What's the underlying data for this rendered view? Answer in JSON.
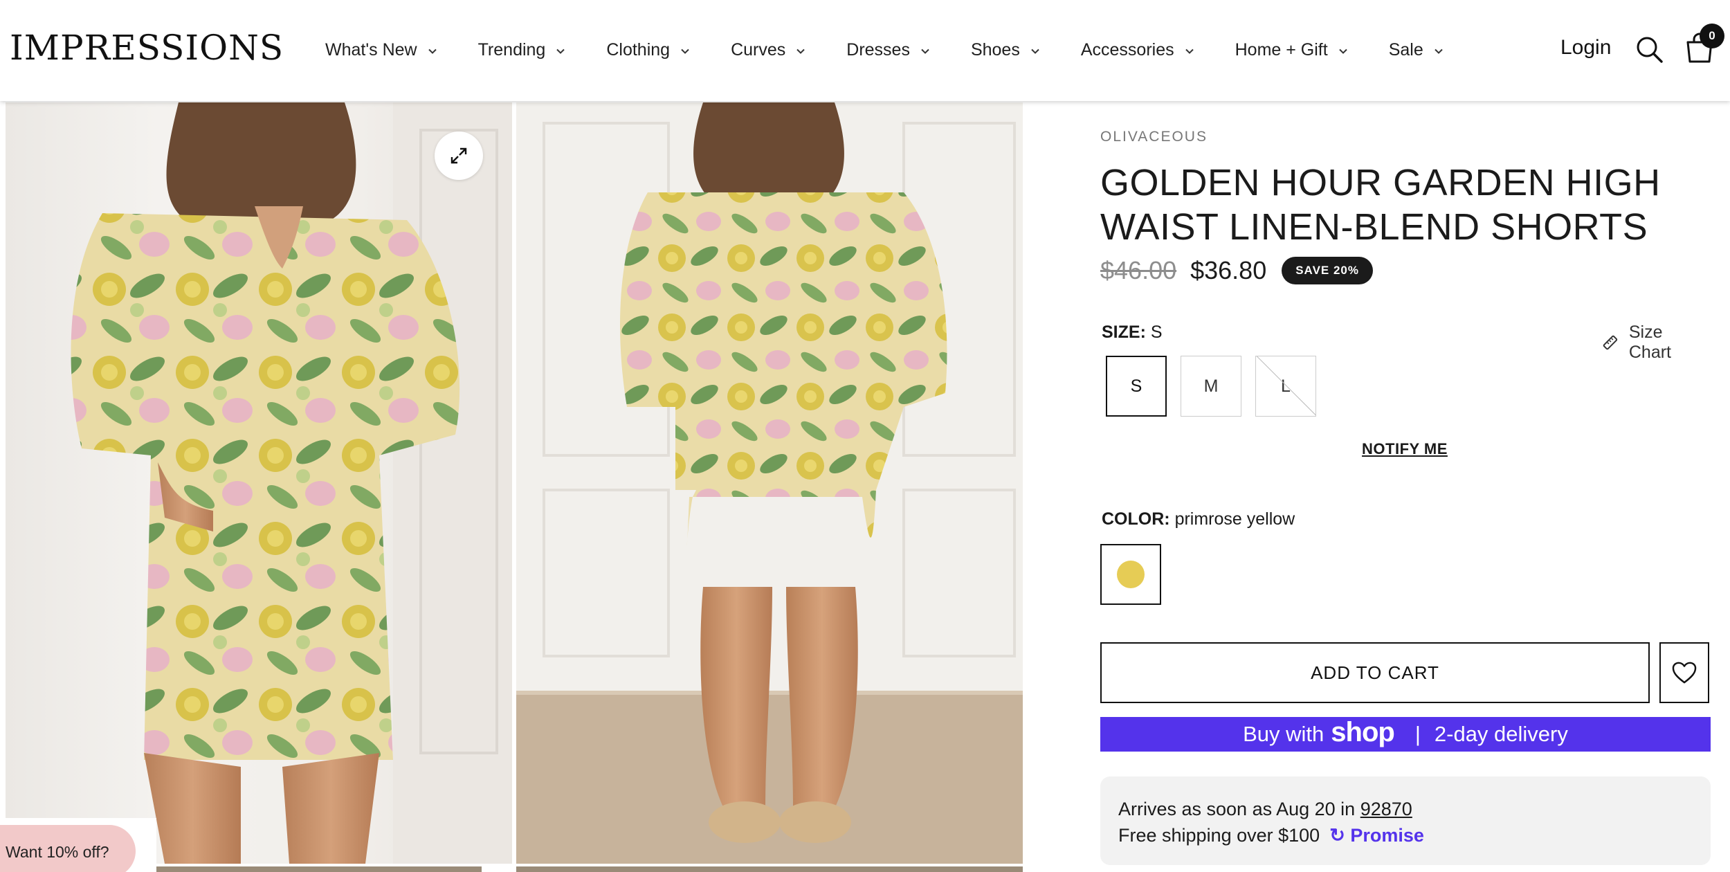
{
  "header": {
    "logo": "IMPRESSIONS",
    "nav": [
      "What's New",
      "Trending",
      "Clothing",
      "Curves",
      "Dresses",
      "Shoes",
      "Accessories",
      "Home + Gift",
      "Sale"
    ],
    "login": "Login",
    "cart_count": "0"
  },
  "gallery": {
    "promo": "Want 10% off?"
  },
  "product": {
    "brand": "OLIVACEOUS",
    "title": "GOLDEN HOUR GARDEN HIGH WAIST LINEN-BLEND SHORTS",
    "old_price": "$46.00",
    "new_price": "$36.80",
    "save_badge": "SAVE 20%",
    "size_label": "SIZE:",
    "size_value": "S",
    "size_chart": "Size Chart",
    "sizes": [
      {
        "label": "S",
        "state": "selected"
      },
      {
        "label": "M",
        "state": "available"
      },
      {
        "label": "L",
        "state": "sold-out"
      }
    ],
    "notify": "NOTIFY ME",
    "color_label": "COLOR:",
    "color_value": "primrose yellow",
    "color_swatch": "#e6cc55",
    "add_to_cart": "ADD TO CART",
    "shop_pay": {
      "prefix": "Buy with",
      "brand": "shop",
      "suffix": "2-day delivery",
      "color": "#5433eb"
    },
    "delivery": {
      "arrives": "Arrives as soon as Aug 20 in",
      "zip": "92870",
      "shipping": "Free shipping over $100",
      "promise": "Promise"
    }
  },
  "colors": {
    "accent": "#1b1b1b",
    "promo_bg": "#f2c9c9",
    "shop_pay": "#5433eb",
    "promise": "#5433eb"
  }
}
